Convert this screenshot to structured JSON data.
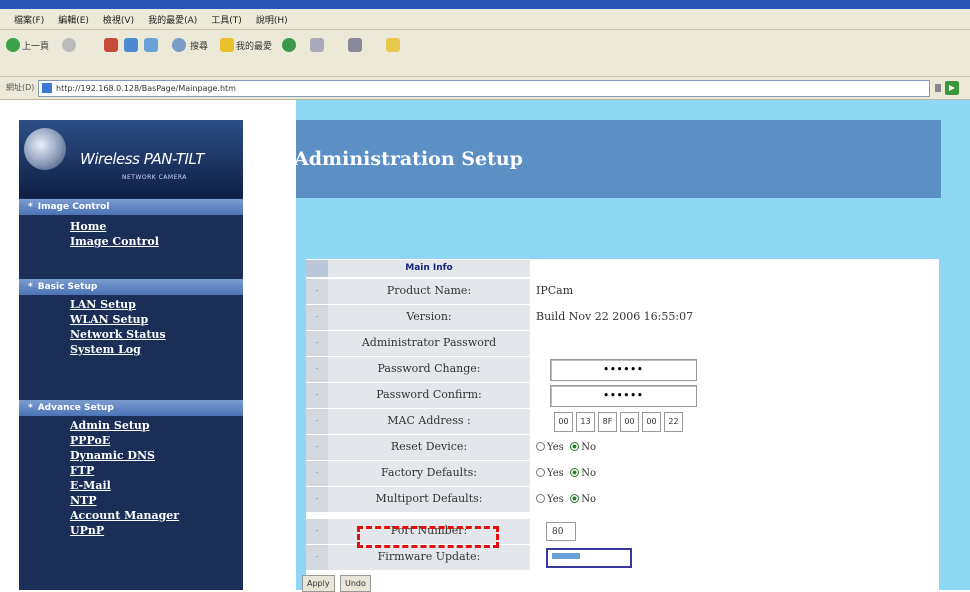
{
  "browser": {
    "menu": [
      "檔案(F)",
      "編輯(E)",
      "檢視(V)",
      "我的最愛(A)",
      "工具(T)",
      "說明(H)"
    ],
    "toolbar": {
      "back": "上一頁",
      "search": "搜尋",
      "favorites": "我的最愛"
    },
    "address_label": "網址(D)",
    "address": "http://192.168.0.128/BasPage/Mainpage.htm"
  },
  "logo": {
    "title": "Wireless PAN-TILT",
    "subtitle": "NETWORK CAMERA"
  },
  "sidebar": {
    "sections": [
      {
        "title": "Image Control",
        "links": [
          "Home",
          "Image Control"
        ]
      },
      {
        "title": "Basic Setup",
        "links": [
          "LAN Setup",
          "WLAN Setup",
          "Network Status",
          "System Log"
        ]
      },
      {
        "title": "Advance Setup",
        "links": [
          "Admin Setup",
          "PPPoE",
          "Dynamic DNS",
          "FTP",
          "E-Mail",
          "NTP",
          "Account Manager",
          "UPnP"
        ]
      }
    ]
  },
  "banner": {
    "title": "Administration Setup"
  },
  "form": {
    "header": "Main Info",
    "product_name_label": "Product Name:",
    "product_name": "IPCam",
    "version_label": "Version:",
    "version": "Build Nov 22 2006 16:55:07",
    "admin_password_label": "Administrator Password",
    "password_change_label": "Password Change:",
    "password_change_value": "••••••",
    "password_confirm_label": "Password Confirm:",
    "password_confirm_value": "••••••",
    "mac_label": "MAC Address :",
    "mac": [
      "00",
      "13",
      "8F",
      "00",
      "00",
      "22"
    ],
    "reset_label": "Reset Device:",
    "factory_label": "Factory Defaults:",
    "multiport_label": "Multiport Defaults:",
    "yes": "Yes",
    "no": "No",
    "port_label": "Port Number:",
    "port_value": "80",
    "firmware_label": "Firmware Update:",
    "row_marker": "-"
  },
  "buttons": {
    "apply": "Apply",
    "undo": "Undo"
  }
}
